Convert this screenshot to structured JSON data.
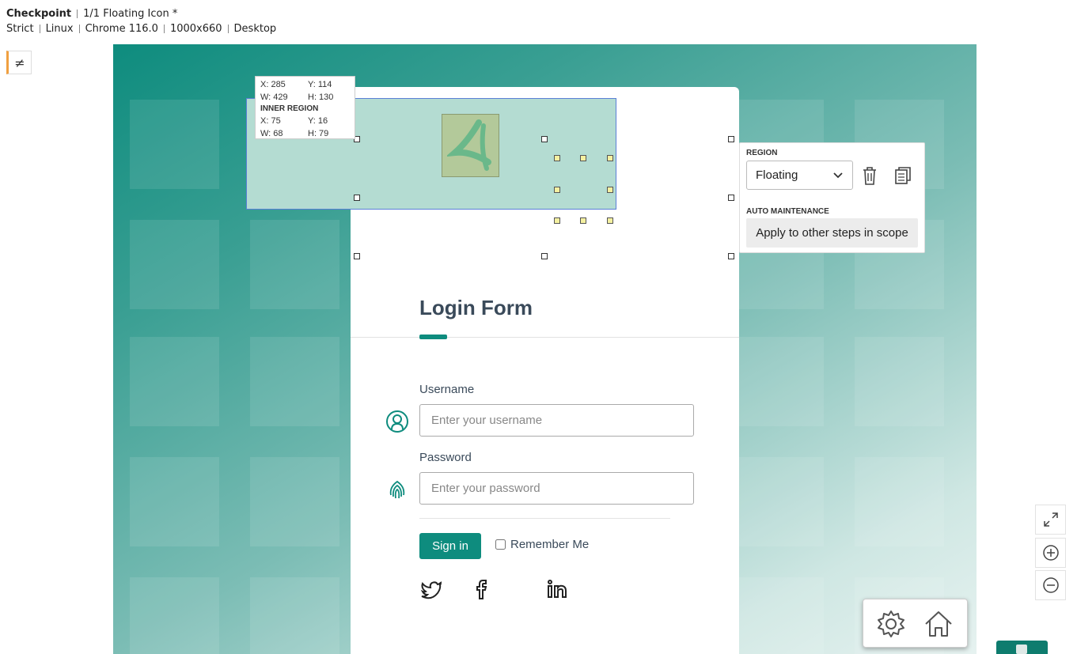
{
  "header": {
    "title": "Checkpoint",
    "step": "1/1 Floating Icon *",
    "mode": "Strict",
    "os": "Linux",
    "browser": "Chrome 116.0",
    "viewport": "1000x660",
    "device": "Desktop"
  },
  "diff_toggle": {
    "symbol": "≠"
  },
  "coords_box": {
    "x": "X: 285",
    "y": "Y: 114",
    "w": "W: 429",
    "h": "H: 130",
    "inner_label": "INNER REGION",
    "ix": "X: 75",
    "iy": "Y: 16",
    "iw": "W: 68",
    "ih": "H: 79"
  },
  "region_panel": {
    "region_caption": "REGION",
    "region_value": "Floating",
    "auto_caption": "AUTO MAINTENANCE",
    "apply_label": "Apply to other steps in scope"
  },
  "login": {
    "title": "Login Form",
    "username_label": "Username",
    "username_placeholder": "Enter your username",
    "password_label": "Password",
    "password_placeholder": "Enter your password",
    "signin_label": "Sign in",
    "remember_label": "Remember Me"
  },
  "colors": {
    "accent": "#0e8c7e",
    "region_border": "#5a7fd6",
    "panel_bg": "#ffffff"
  },
  "icons": [
    "not-equal-icon",
    "user-icon",
    "fingerprint-icon",
    "twitter-icon",
    "facebook-icon",
    "linkedin-icon",
    "trash-icon",
    "copy-icon",
    "chevron-down-icon",
    "fit-screen-icon",
    "zoom-in-icon",
    "zoom-out-icon",
    "gear-icon",
    "home-icon"
  ]
}
